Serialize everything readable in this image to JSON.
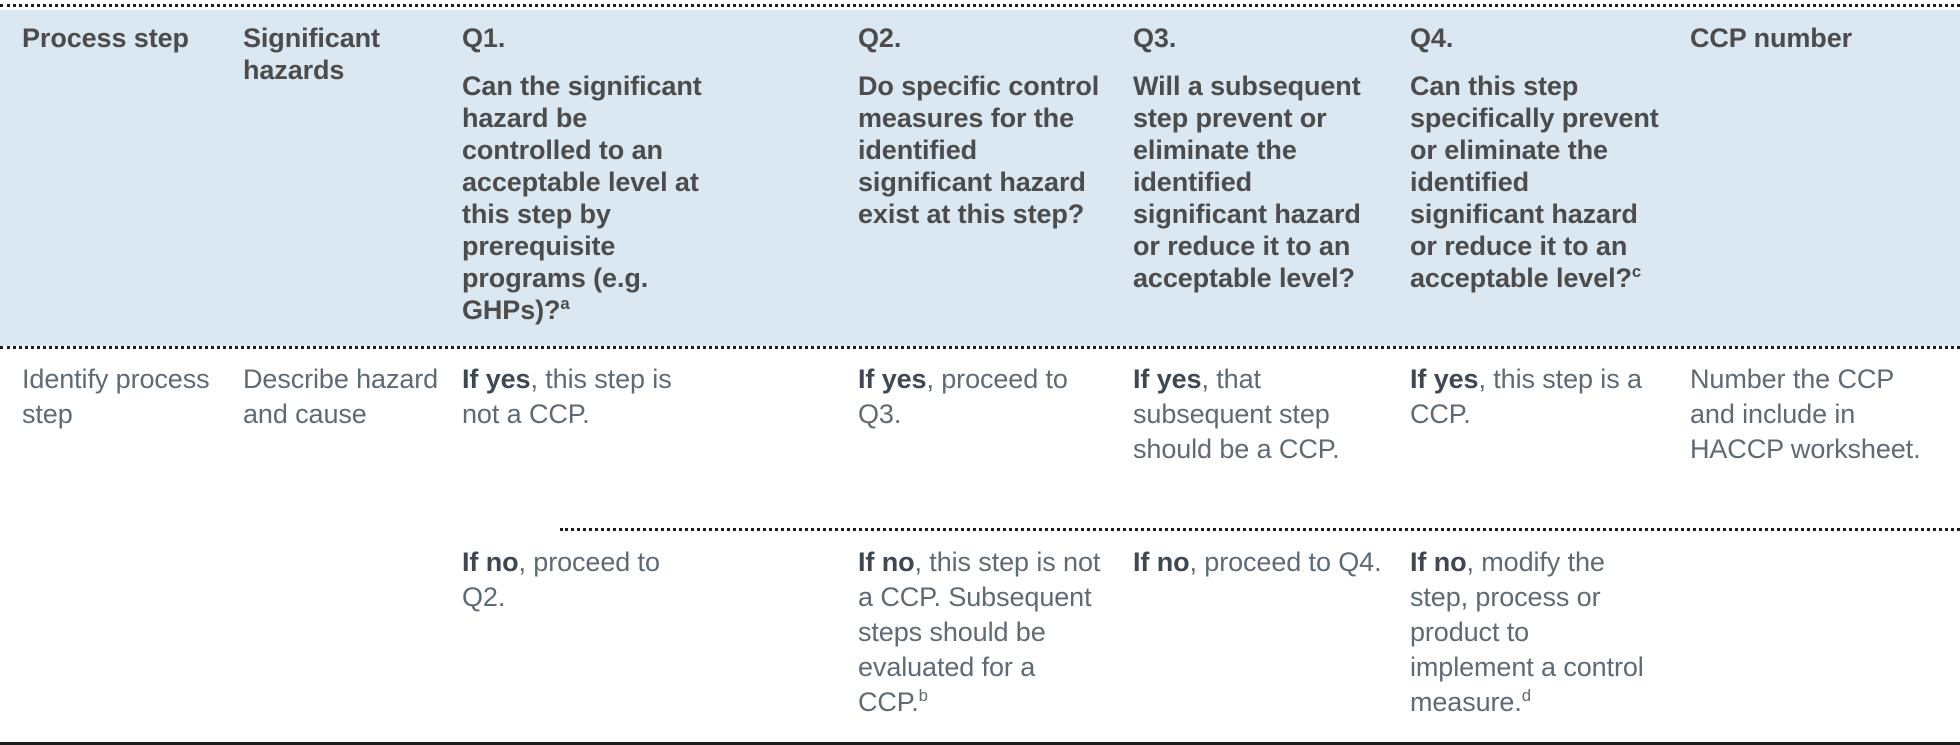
{
  "table": {
    "header_background": "#dbe8f2",
    "header_text_color": "#4c4c4c",
    "body_text_color": "#5f6a74",
    "columns": [
      {
        "id": "process-step",
        "title": "Process step",
        "qnum": "",
        "question": ""
      },
      {
        "id": "significant-hazards",
        "title": "Significant hazards",
        "qnum": "",
        "question": ""
      },
      {
        "id": "q1",
        "title": "",
        "qnum": "Q1.",
        "question": "Can the significant hazard be controlled to an acceptable level at this step by prerequisite programs (e.g. GHPs)?",
        "footnote": "a"
      },
      {
        "id": "q2",
        "title": "",
        "qnum": "Q2.",
        "question": "Do specific control measures for the identified significant hazard exist at this step?",
        "footnote": ""
      },
      {
        "id": "q3",
        "title": "",
        "qnum": "Q3.",
        "question": "Will a subsequent step prevent or eliminate the identified significant hazard or reduce it to an acceptable level?",
        "footnote": ""
      },
      {
        "id": "q4",
        "title": "",
        "qnum": "Q4.",
        "question": "Can this step specifically prevent or eliminate the identified significant hazard or reduce it to an acceptable level?",
        "footnote": "c"
      },
      {
        "id": "ccp-number",
        "title": "CCP number",
        "qnum": "",
        "question": ""
      }
    ],
    "rows": [
      {
        "id": "row-yes",
        "cells": {
          "process_step": "Identify process step",
          "significant_hazards": "Describe hazard and cause",
          "q1_lead": "If yes",
          "q1_rest": ", this step is not a CCP.",
          "q2_lead": "If yes",
          "q2_rest": ", proceed to Q3.",
          "q3_lead": "If yes",
          "q3_rest": ", that subsequent step should be a CCP.",
          "q4_lead": "If yes",
          "q4_rest": ", this step is a CCP.",
          "ccp_number": "Number the CCP and include in HACCP worksheet."
        }
      },
      {
        "id": "row-no",
        "cells": {
          "process_step": "",
          "significant_hazards": "",
          "q1_lead": "If no",
          "q1_rest": ", proceed to Q2.",
          "q2_lead": "If no",
          "q2_rest": ", this step is not a CCP. Subsequent steps should be evaluated for a CCP.",
          "q2_footnote": "b",
          "q3_lead": "If no",
          "q3_rest": ", proceed to Q4.",
          "q4_lead": "If no",
          "q4_rest": ", modify the step, process or product to implement a control measure.",
          "q4_footnote": "d",
          "ccp_number": ""
        }
      }
    ]
  }
}
